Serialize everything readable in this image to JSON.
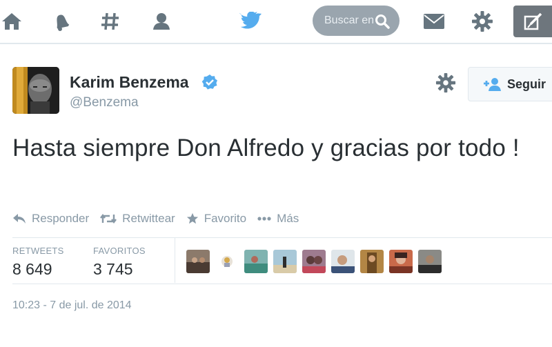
{
  "nav": {
    "icons": [
      "home-icon",
      "notifications-icon",
      "discover-icon",
      "me-icon"
    ],
    "search": {
      "placeholder": "Buscar en Twitter"
    },
    "brand_color": "#55acee"
  },
  "tweet": {
    "author": {
      "name": "Karim Benzema",
      "handle": "@Benzema",
      "verified": true
    },
    "follow_label": "Seguir",
    "text": "Hasta siempre Don Alfredo y gracias por todo !",
    "actions": {
      "reply": "Responder",
      "retweet": "Retwittear",
      "favorite": "Favorito",
      "more": "Más"
    },
    "stats": {
      "retweets_label": "RETWEETS",
      "retweets_value": "8 649",
      "favorites_label": "FAVORITOS",
      "favorites_value": "3 745"
    },
    "timestamp": "10:23 - 7 de jul. de 2014"
  }
}
